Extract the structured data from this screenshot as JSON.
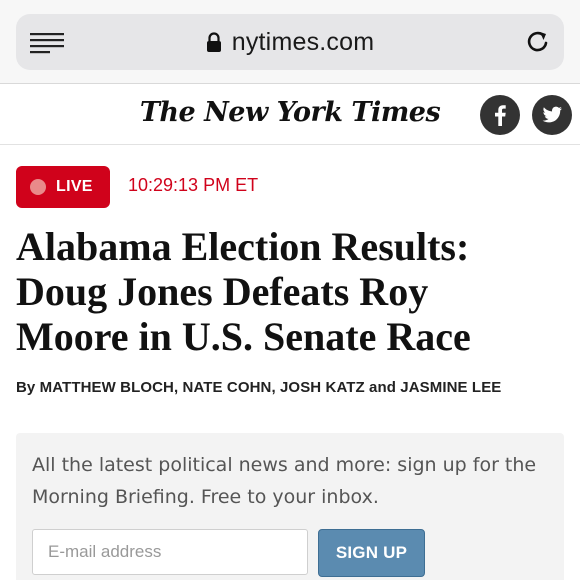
{
  "browser": {
    "url": "nytimes.com",
    "icons": {
      "menu": "menu-icon",
      "lock": "lock-icon",
      "reload": "reload-icon"
    }
  },
  "header": {
    "masthead": "The New York Times",
    "social": [
      {
        "name": "facebook-icon",
        "glyph": "f"
      },
      {
        "name": "twitter-icon"
      }
    ]
  },
  "live": {
    "label": "LIVE",
    "time": "10:29:13 PM ET",
    "color": "#d0021b"
  },
  "article": {
    "headline_lines": [
      "Alabama Election Results:",
      "Doug Jones Defeats Roy",
      "Moore in U.S. Senate Race"
    ],
    "byline": "By MATTHEW BLOCH, NATE COHN, JOSH KATZ and JASMINE LEE"
  },
  "newsletter": {
    "text": "All the latest political news and more: sign up for the Morning Briefing. Free to your inbox.",
    "email_placeholder": "E-mail address",
    "signup_label": "SIGN UP",
    "button_color": "#5b8bb0"
  }
}
